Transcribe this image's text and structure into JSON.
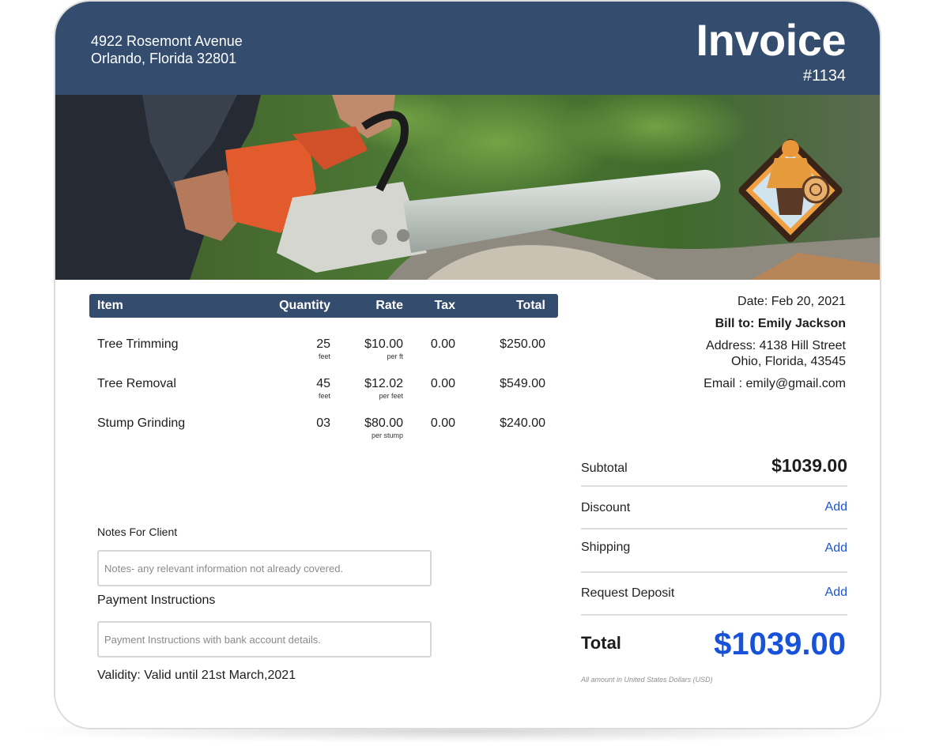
{
  "company": {
    "address_line1": "4922 Rosemont Avenue",
    "address_line2": "Orlando, Florida 32801"
  },
  "invoice": {
    "title": "Invoice",
    "number": "#1134"
  },
  "banner": {
    "photo_icon": "chainsaw-cutting-log-photo",
    "logo_icon": "lumberjack-badge-icon"
  },
  "table": {
    "headers": {
      "item": "Item",
      "quantity": "Quantity",
      "rate": "Rate",
      "tax": "Tax",
      "total": "Total"
    },
    "rows": [
      {
        "item": "Tree Trimming",
        "qty": "25",
        "qty_unit": "feet",
        "rate": "$10.00",
        "rate_unit": "per ft",
        "tax": "0.00",
        "total": "$250.00"
      },
      {
        "item": "Tree Removal",
        "qty": "45",
        "qty_unit": "feet",
        "rate": "$12.02",
        "rate_unit": "per feet",
        "tax": "0.00",
        "total": "$549.00"
      },
      {
        "item": "Stump Grinding",
        "qty": "03",
        "qty_unit": "",
        "rate": "$80.00",
        "rate_unit": "per stump",
        "tax": "0.00",
        "total": "$240.00"
      }
    ]
  },
  "meta": {
    "date": "Date: Feb 20, 2021",
    "bill_to": "Bill to: Emily Jackson",
    "address_line1": "Address: 4138 Hill Street",
    "address_line2": "Ohio, Florida, 43545",
    "email": "Email : emily@gmail.com"
  },
  "notes": {
    "label": "Notes For Client",
    "placeholder": "Notes- any relevant information not already covered."
  },
  "payment": {
    "label": "Payment Instructions",
    "placeholder": "Payment Instructions with bank account details."
  },
  "validity": "Validity: Valid until 21st March,2021",
  "summary": {
    "subtotal_label": "Subtotal",
    "subtotal_value": "$1039.00",
    "discount_label": "Discount",
    "shipping_label": "Shipping",
    "deposit_label": "Request Deposit",
    "add_label": "Add",
    "total_label": "Total",
    "total_value": "$1039.00",
    "currency_note": "All amount in United States Dollars (USD)"
  },
  "colors": {
    "header": "#344d6e",
    "accent_blue": "#1852d8",
    "link_blue": "#1a56d6"
  }
}
